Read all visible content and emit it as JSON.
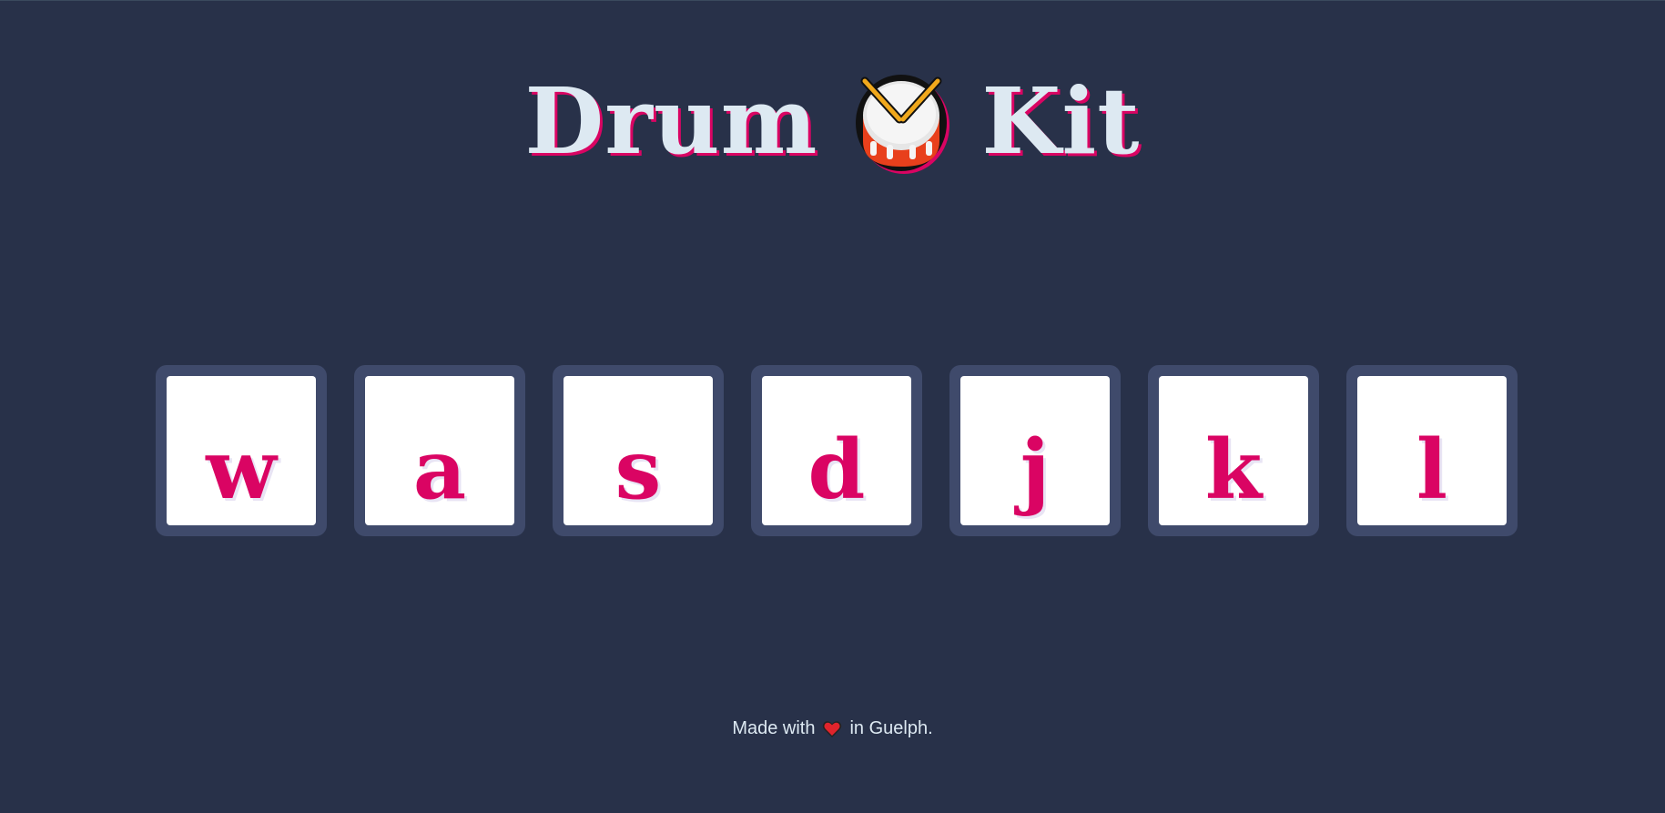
{
  "title": {
    "word1": "Drum",
    "icon": "drum-icon",
    "word2": "Kit"
  },
  "keys": [
    "w",
    "a",
    "s",
    "d",
    "j",
    "k",
    "l"
  ],
  "footer": {
    "prefix": "Made with",
    "icon": "heart-icon",
    "suffix": "in Guelph."
  },
  "colors": {
    "background": "#283149",
    "key_border": "#3f4a6b",
    "key_face": "#ffffff",
    "accent": "#da0463",
    "title_text": "#dde9f2"
  }
}
